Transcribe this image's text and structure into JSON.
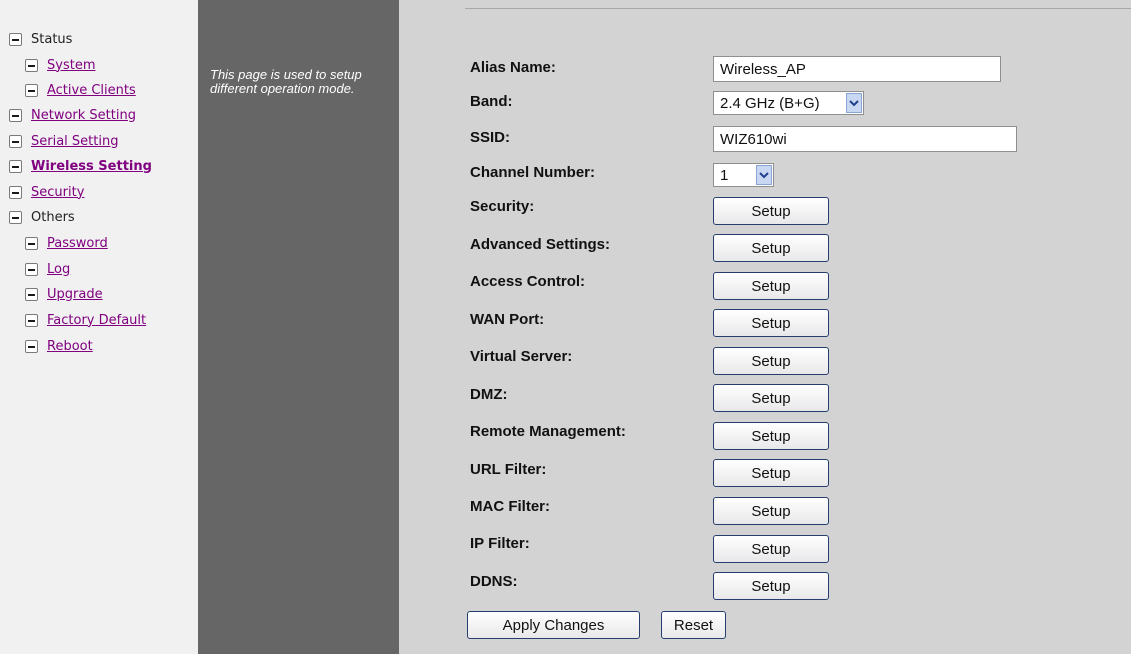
{
  "nav": {
    "items": [
      {
        "label": "Status"
      },
      {
        "label": "System"
      },
      {
        "label": "Active Clients"
      },
      {
        "label": "Network Setting"
      },
      {
        "label": "Serial Setting"
      },
      {
        "label": "Wireless Setting"
      },
      {
        "label": "Security"
      },
      {
        "label": "Others"
      },
      {
        "label": "Password"
      },
      {
        "label": "Log"
      },
      {
        "label": "Upgrade"
      },
      {
        "label": "Factory Default"
      },
      {
        "label": "Reboot"
      }
    ]
  },
  "help": {
    "text": "This page is used to setup different operation mode."
  },
  "form": {
    "alias_label": "Alias Name:",
    "alias_value": "Wireless_AP",
    "band_label": "Band:",
    "band_value": "2.4 GHz (B+G)",
    "ssid_label": "SSID:",
    "ssid_value": "WIZ610wi",
    "channel_label": "Channel Number:",
    "channel_value": "1",
    "setup_rows": [
      {
        "label": "Security:",
        "button": "Setup"
      },
      {
        "label": "Advanced Settings:",
        "button": "Setup"
      },
      {
        "label": "Access Control:",
        "button": "Setup"
      },
      {
        "label": "WAN Port:",
        "button": "Setup"
      },
      {
        "label": "Virtual Server:",
        "button": "Setup"
      },
      {
        "label": "DMZ:",
        "button": "Setup"
      },
      {
        "label": "Remote Management:",
        "button": "Setup"
      },
      {
        "label": "URL Filter:",
        "button": "Setup"
      },
      {
        "label": "MAC Filter:",
        "button": "Setup"
      },
      {
        "label": "IP Filter:",
        "button": "Setup"
      },
      {
        "label": "DDNS:",
        "button": "Setup"
      }
    ],
    "apply_label": "Apply Changes",
    "reset_label": "Reset"
  },
  "colors": {
    "nav_bg": "#f1f1f1",
    "help_bg": "#666666",
    "main_bg": "#d3d3d3",
    "link": "#800080",
    "button_border": "#263e6f"
  },
  "icons": {
    "nav_bullet": "collapse-minus-icon",
    "dropdown": "chevron-down-icon"
  }
}
